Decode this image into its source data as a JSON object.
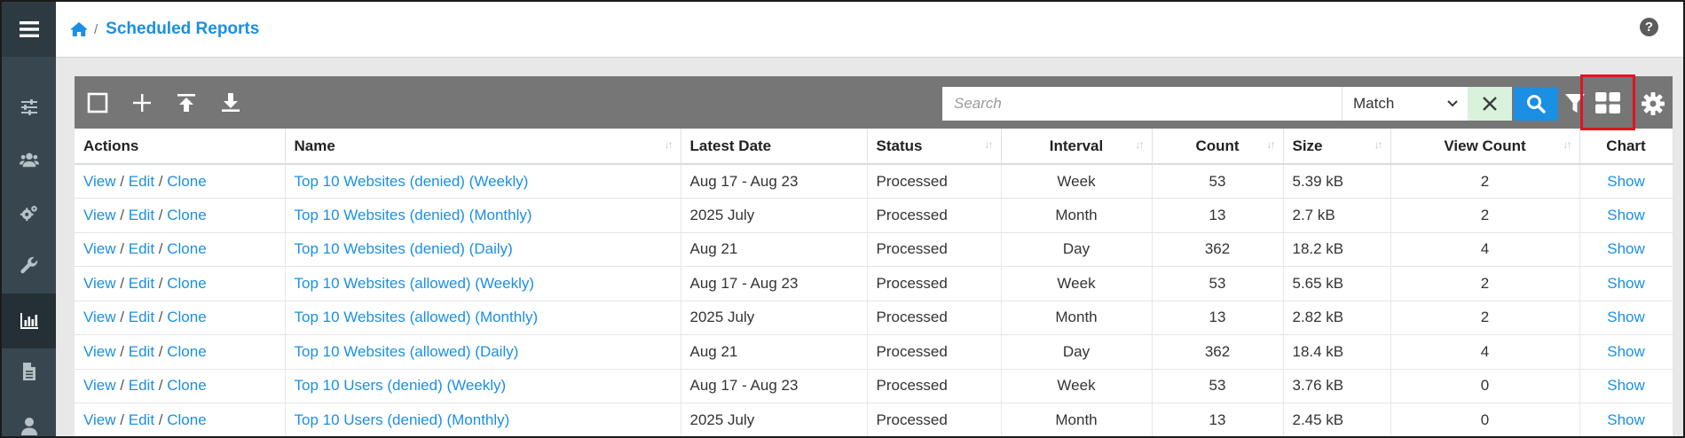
{
  "header": {
    "title": "Scheduled Reports",
    "separator": "/",
    "help": "?"
  },
  "sidebar": {
    "items": [
      {
        "icon": "menu-icon"
      },
      {
        "icon": "sliders-icon"
      },
      {
        "icon": "users-icon"
      },
      {
        "icon": "gears-icon"
      },
      {
        "icon": "wrench-icon"
      },
      {
        "icon": "bar-chart-icon",
        "active": true
      },
      {
        "icon": "document-icon"
      },
      {
        "icon": "user-icon"
      }
    ]
  },
  "toolbar": {
    "search_placeholder": "Search",
    "match_value": "Match"
  },
  "table": {
    "columns": [
      "Actions",
      "Name",
      "Latest Date",
      "Status",
      "Interval",
      "Count",
      "Size",
      "View Count",
      "Chart"
    ],
    "action_labels": {
      "view": "View",
      "edit": "Edit",
      "clone": "Clone",
      "sep": "/"
    },
    "chart_label": "Show",
    "rows": [
      {
        "name": "Top 10 Websites (denied) (Weekly)",
        "latest": "Aug 17 - Aug 23",
        "status": "Processed",
        "interval": "Week",
        "count": "53",
        "size": "5.39 kB",
        "views": "2"
      },
      {
        "name": "Top 10 Websites (denied) (Monthly)",
        "latest": "2025 July",
        "status": "Processed",
        "interval": "Month",
        "count": "13",
        "size": "2.7 kB",
        "views": "2"
      },
      {
        "name": "Top 10 Websites (denied) (Daily)",
        "latest": "Aug 21",
        "status": "Processed",
        "interval": "Day",
        "count": "362",
        "size": "18.2 kB",
        "views": "4"
      },
      {
        "name": "Top 10 Websites (allowed) (Weekly)",
        "latest": "Aug 17 - Aug 23",
        "status": "Processed",
        "interval": "Week",
        "count": "53",
        "size": "5.65 kB",
        "views": "2"
      },
      {
        "name": "Top 10 Websites (allowed) (Monthly)",
        "latest": "2025 July",
        "status": "Processed",
        "interval": "Month",
        "count": "13",
        "size": "2.82 kB",
        "views": "2"
      },
      {
        "name": "Top 10 Websites (allowed) (Daily)",
        "latest": "Aug 21",
        "status": "Processed",
        "interval": "Day",
        "count": "362",
        "size": "18.4 kB",
        "views": "4"
      },
      {
        "name": "Top 10 Users (denied) (Weekly)",
        "latest": "Aug 17 - Aug 23",
        "status": "Processed",
        "interval": "Week",
        "count": "53",
        "size": "3.76 kB",
        "views": "0"
      },
      {
        "name": "Top 10 Users (denied) (Monthly)",
        "latest": "2025 July",
        "status": "Processed",
        "interval": "Month",
        "count": "13",
        "size": "2.45 kB",
        "views": "0"
      }
    ]
  }
}
